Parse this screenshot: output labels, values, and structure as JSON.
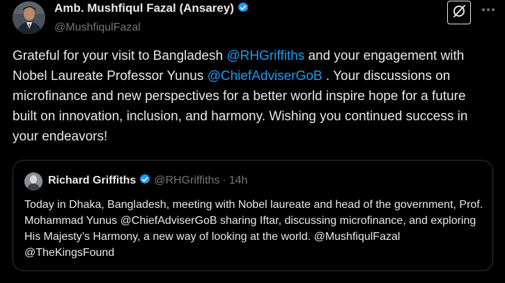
{
  "tweet": {
    "author": {
      "name": "Amb. Mushfiqul Fazal (Ansarey)",
      "handle": "@MushfiqulFazal",
      "verified": true
    },
    "text_segments": [
      {
        "text": "Grateful for your visit to Bangladesh ",
        "type": "text"
      },
      {
        "text": "@RHGriffiths",
        "type": "mention"
      },
      {
        "text": "  and your engagement with Nobel Laureate Professor Yunus ",
        "type": "text"
      },
      {
        "text": "@ChiefAdviserGoB",
        "type": "mention"
      },
      {
        "text": " . Your discussions on microfinance and new perspectives for a better world inspire hope for a future built on innovation, inclusion, and harmony. Wishing you continued success in your endeavors!",
        "type": "text"
      }
    ]
  },
  "quoted_tweet": {
    "author": {
      "name": "Richard Griffiths",
      "handle": "@RHGriffiths",
      "separator": "·",
      "time": "14h",
      "verified": true
    },
    "text": "Today in Dhaka, Bangladesh, meeting with Nobel laureate and head of the government, Prof. Mohammad Yunus  @ChiefAdviserGoB sharing Iftar, discussing microfinance, and exploring His Majesty’s Harmony, a new way of looking at the world.  @MushfiqulFazal @TheKingsFound"
  },
  "icons": {
    "verified": "verified-badge-icon",
    "grok": "grok-icon",
    "more": "more-options-icon"
  },
  "colors": {
    "background": "#000000",
    "text": "#e7e9ea",
    "secondary": "#71767b",
    "accent": "#1d9bf0",
    "border": "#2f3336"
  }
}
